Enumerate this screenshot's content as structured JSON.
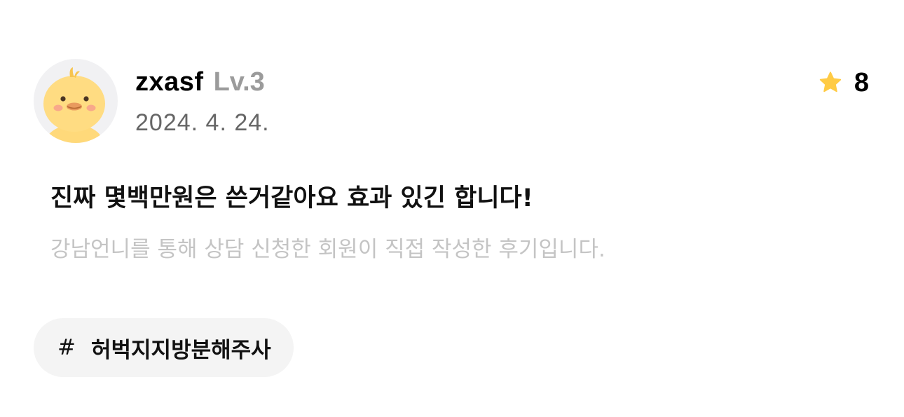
{
  "review": {
    "user": {
      "avatar_icon": "chick-avatar-icon",
      "name": "zxasf",
      "level": "Lv.3"
    },
    "date": "2024. 4. 24.",
    "rating": {
      "icon": "star-icon",
      "value": "8",
      "star_color": "#FFCB45"
    },
    "title": "진짜 몇백만원은 쓴거같아요 효과 있긴 합니다!",
    "notice": "강남언니를 통해 상담 신청한 회원이 직접 작성한 후기입니다.",
    "tags": [
      {
        "hash": "#",
        "label": "허벅지지방분해주사"
      }
    ]
  }
}
